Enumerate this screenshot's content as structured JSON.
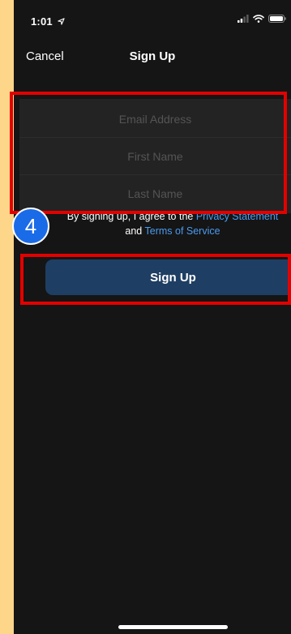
{
  "status_bar": {
    "time": "1:01",
    "location_icon": "location-arrow-icon",
    "signal_icon": "cellular-signal-icon",
    "wifi_icon": "wifi-icon",
    "battery_icon": "battery-icon"
  },
  "nav": {
    "cancel_label": "Cancel",
    "title": "Sign Up"
  },
  "form": {
    "email_placeholder": "Email Address",
    "first_name_placeholder": "First Name",
    "last_name_placeholder": "Last Name"
  },
  "step_badge": "4",
  "agreement": {
    "prefix": "By signing up, I agree to the ",
    "privacy_link": "Privacy Statement",
    "conjunction": " and ",
    "terms_link": "Terms of Service"
  },
  "signup_button_label": "Sign Up",
  "colors": {
    "background": "#FDD68A",
    "screen": "#151515",
    "field_background": "#232323",
    "link": "#4A9CF0",
    "primary_button": "#1F3E63",
    "highlight": "#E40000",
    "badge": "#1A6BE8"
  }
}
